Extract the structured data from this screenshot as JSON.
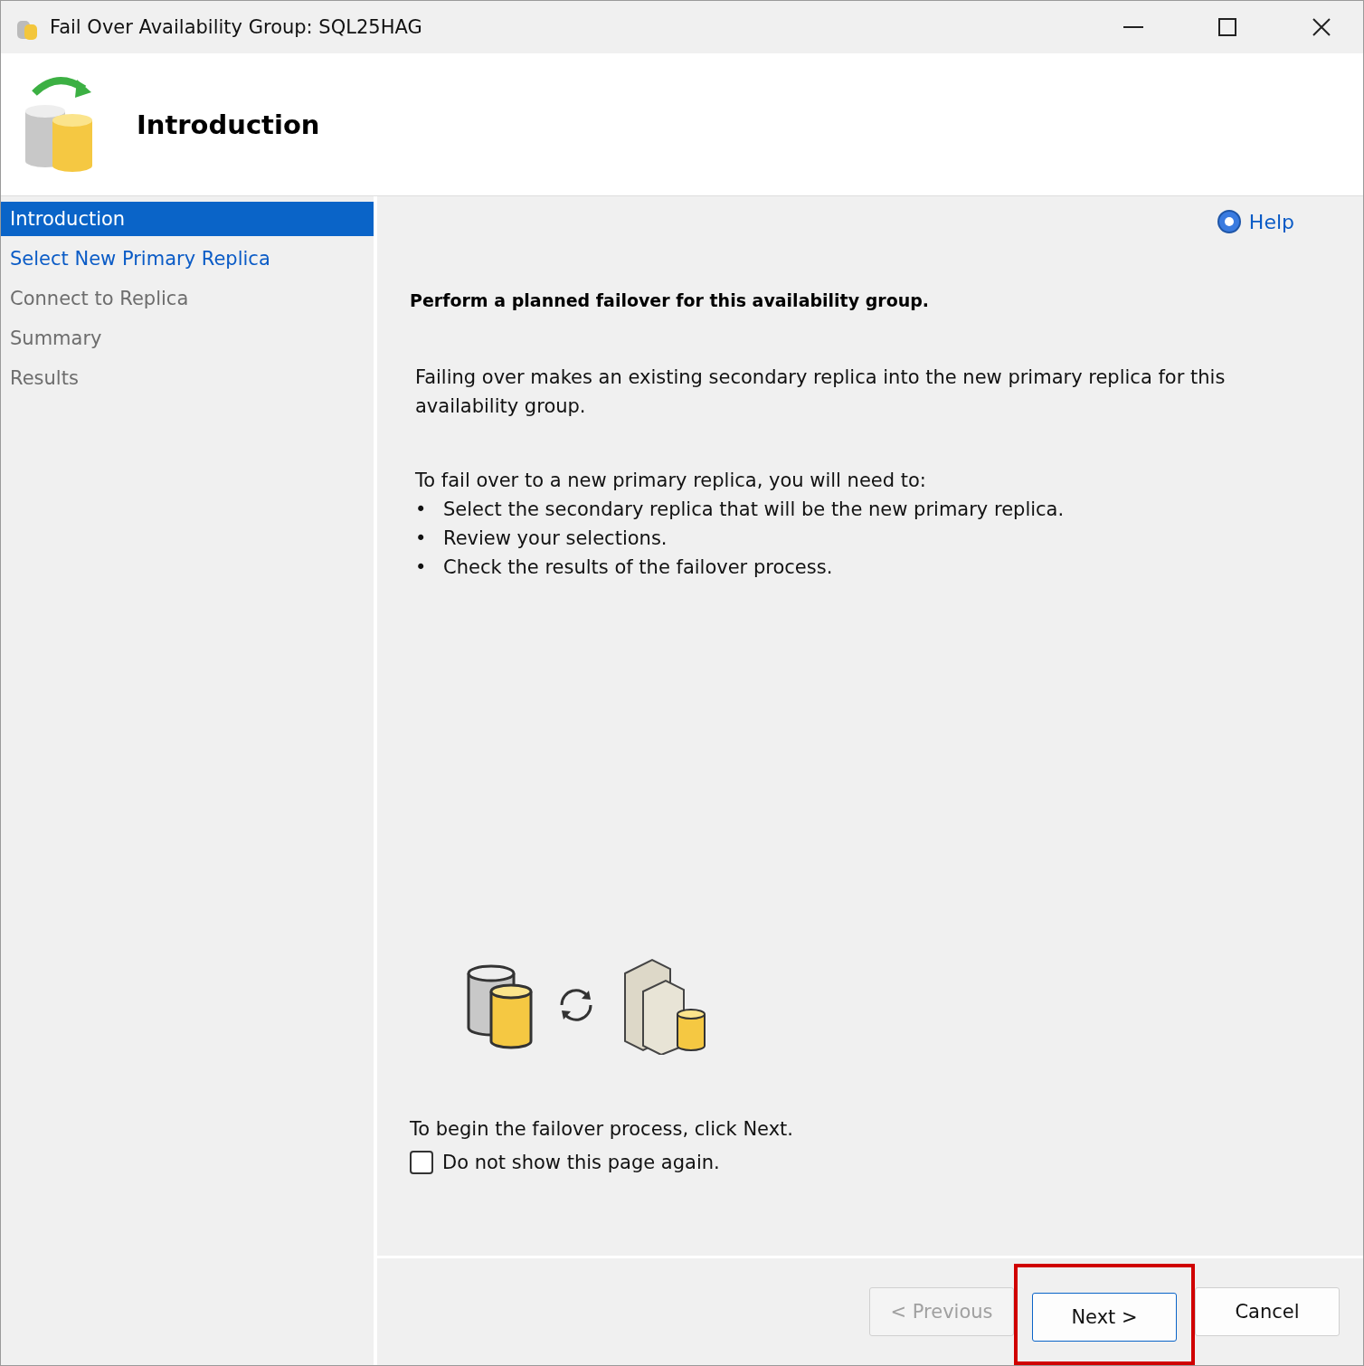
{
  "window": {
    "title": "Fail Over Availability Group: SQL25HAG"
  },
  "header": {
    "title": "Introduction"
  },
  "nav": [
    {
      "label": "Introduction",
      "selected": true,
      "disabled": false
    },
    {
      "label": "Select New Primary Replica",
      "selected": false,
      "disabled": false
    },
    {
      "label": "Connect to Replica",
      "selected": false,
      "disabled": true
    },
    {
      "label": "Summary",
      "selected": false,
      "disabled": true
    },
    {
      "label": "Results",
      "selected": false,
      "disabled": true
    }
  ],
  "help": {
    "label": "Help"
  },
  "content": {
    "heading": "Perform a planned failover for this availability group.",
    "description": "Failing over makes an existing secondary replica into the new primary replica for this availability group.",
    "steps_intro": "To fail over to a new primary replica, you will need to:",
    "steps": [
      {
        "bullet": "•",
        "text": "Select the secondary replica that will be the new primary replica."
      },
      {
        "bullet": "•",
        "text": "Review your selections."
      },
      {
        "bullet": "•",
        "text": "Check the results of the failover process."
      }
    ],
    "begin": "To begin the failover process, click Next.",
    "dont_show": {
      "label": "Do not show this page again.",
      "checked": false
    }
  },
  "buttons": [
    {
      "label": "< Previous",
      "disabled": true,
      "highlighted": false
    },
    {
      "label": "Next >",
      "disabled": false,
      "highlighted": true
    },
    {
      "label": "Cancel",
      "disabled": false,
      "highlighted": false
    }
  ]
}
